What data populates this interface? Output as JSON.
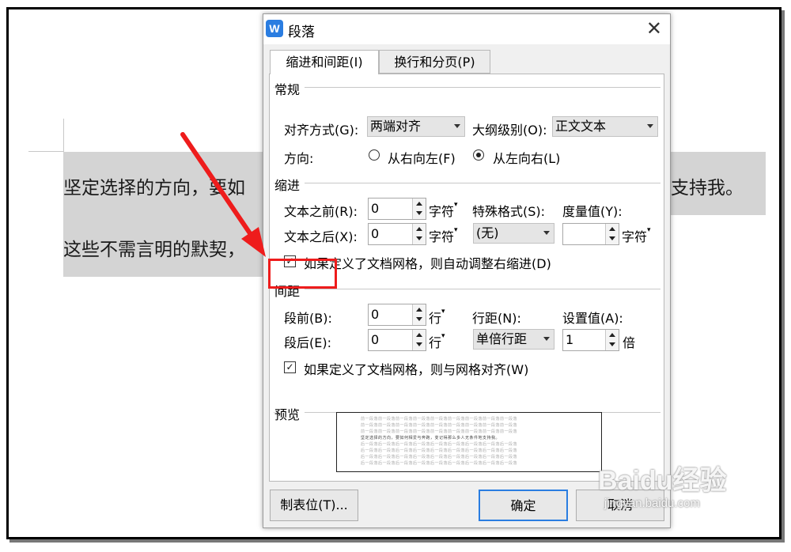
{
  "document": {
    "line1_left": "坚定选择的方向，要如",
    "line1_right": "支持我。",
    "line2": "这些不需言明的默契，"
  },
  "dialog": {
    "title": "段落",
    "app_icon_letter": "W",
    "close_glyph": "✕",
    "tabs": [
      "缩进和间距(I)",
      "换行和分页(P)"
    ],
    "general": {
      "heading": "常规",
      "alignment_label": "对齐方式(G):",
      "alignment_value": "两端对齐",
      "outline_label": "大纲级别(O):",
      "outline_value": "正文文本",
      "direction_label": "方向:",
      "rtl_label": "从右向左(F)",
      "ltr_label": "从左向右(L)",
      "direction_selected": "从左向右(L)"
    },
    "indent": {
      "heading": "缩进",
      "before_label": "文本之前(R):",
      "before_value": "0",
      "before_unit": "字符",
      "after_label": "文本之后(X):",
      "after_value": "0",
      "after_unit": "字符",
      "special_label": "特殊格式(S):",
      "special_value": "(无)",
      "measure_label": "度量值(Y):",
      "measure_value": "",
      "measure_unit": "字符",
      "auto_adjust_label": "如果定义了文档网格，则自动调整右缩进(D)",
      "auto_adjust_checked": true
    },
    "spacing": {
      "heading": "间距",
      "before_label": "段前(B):",
      "before_value": "0",
      "before_unit": "行",
      "after_label": "段后(E):",
      "after_value": "0",
      "after_unit": "行",
      "line_label": "行距(N):",
      "line_value": "单倍行距",
      "setting_label": "设置值(A):",
      "setting_value": "1",
      "setting_unit": "倍",
      "snap_grid_label": "如果定义了文档网格，则与网格对齐(W)",
      "snap_grid_checked": true
    },
    "preview": {
      "heading": "预览",
      "before_line": "前一段落前一段落前一段落前一段落前一段落前一段落前一段落前一段落前一段落",
      "sample_line": "坚定选择的方向，要如何相爱与奔跑，变记得那么多人无条件地支持我。",
      "after_line": "后一段落后一段落后一段落后一段落后一段落后一段落后一段落后一段落后一段落"
    },
    "buttons": {
      "tabs": "制表位(T)...",
      "ok": "确定",
      "cancel": "取消"
    }
  },
  "annotation": {
    "highlight_color": "#ee1c1c"
  },
  "watermark": {
    "logo": "Baidu经验",
    "url": "jingyan.baidu.com"
  }
}
